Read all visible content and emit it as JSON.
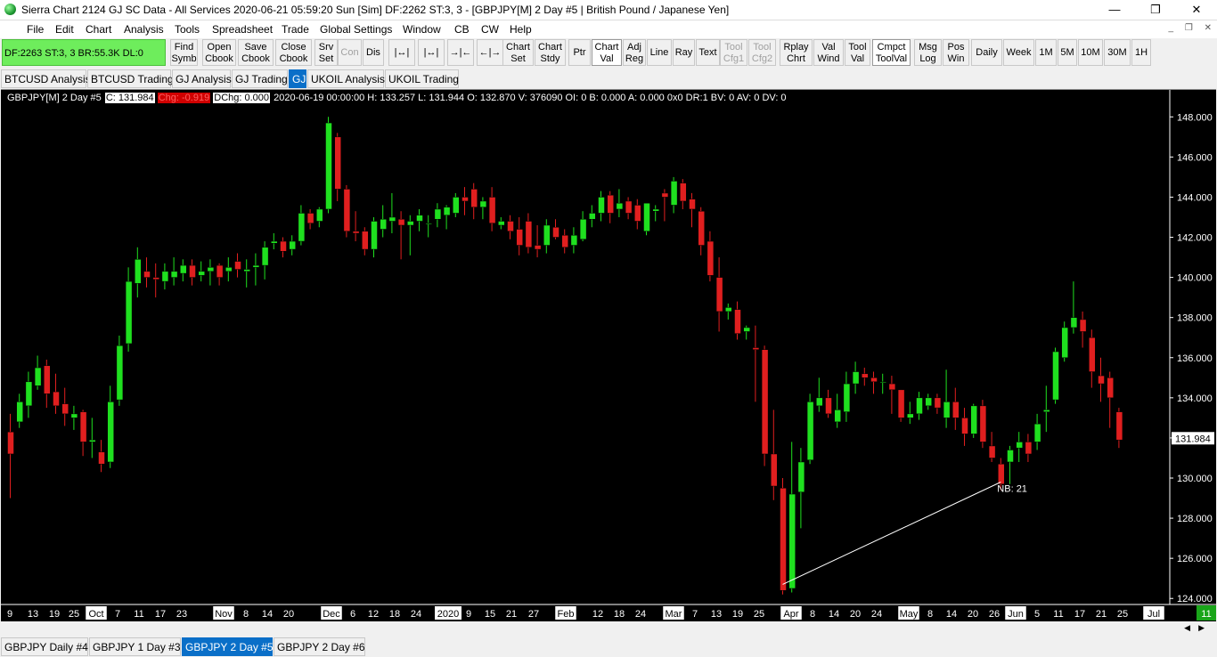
{
  "window": {
    "title": "Sierra Chart 2124 GJ  SC Data - All Services 2020-06-21  05:59:20 Sun [Sim]  DF:2262  ST:3, 3 - [GBPJPY[M]  2 Day  #5 | British Pound / Japanese Yen]",
    "minimize": "—",
    "restore": "❐",
    "close": "✕"
  },
  "menu": [
    "File",
    "Edit",
    "Chart",
    "Analysis",
    "Tools",
    "Spreadsheet",
    "Trade",
    "Global Settings",
    "Window",
    "CB",
    "CW",
    "Help"
  ],
  "mdi": {
    "minimize": "_",
    "restore": "❐",
    "close": "✕"
  },
  "status_box": "DF:2263  ST:3, 3  BR:55.3K  DL:0",
  "toolbar": [
    {
      "id": "find-symb",
      "l1": "Find",
      "l2": "Symb"
    },
    {
      "id": "open-cbook",
      "l1": "Open",
      "l2": "Cbook"
    },
    {
      "id": "save-cbook",
      "l1": "Save",
      "l2": "Cbook"
    },
    {
      "id": "close-cbook",
      "l1": "Close",
      "l2": "Cbook"
    },
    {
      "id": "srv-set",
      "l1": "Srv",
      "l2": "Set"
    },
    {
      "id": "con",
      "l1": "Con",
      "l2": ""
    },
    {
      "id": "dis",
      "l1": "Dis",
      "l2": ""
    },
    {
      "id": "zoom-1",
      "l1": "|↔|",
      "l2": ""
    },
    {
      "id": "zoom-2",
      "l1": "|↔|",
      "l2": ""
    },
    {
      "id": "zoom-3",
      "l1": "→|←",
      "l2": ""
    },
    {
      "id": "zoom-4",
      "l1": "←|→",
      "l2": ""
    },
    {
      "id": "chart-set",
      "l1": "Chart",
      "l2": "Set"
    },
    {
      "id": "chart-stdy",
      "l1": "Chart",
      "l2": "Stdy"
    },
    {
      "id": "ptr",
      "l1": "Ptr",
      "l2": ""
    },
    {
      "id": "chart-val",
      "l1": "Chart",
      "l2": "Val"
    },
    {
      "id": "adj-reg",
      "l1": "Adj",
      "l2": "Reg"
    },
    {
      "id": "line",
      "l1": "Line",
      "l2": ""
    },
    {
      "id": "ray",
      "l1": "Ray",
      "l2": ""
    },
    {
      "id": "text",
      "l1": "Text",
      "l2": ""
    },
    {
      "id": "tool-cfg1",
      "l1": "Tool",
      "l2": "Cfg1"
    },
    {
      "id": "tool-cfg2",
      "l1": "Tool",
      "l2": "Cfg2"
    },
    {
      "id": "rplay-chrt",
      "l1": "Rplay",
      "l2": "Chrt"
    },
    {
      "id": "val-wind",
      "l1": "Val",
      "l2": "Wind"
    },
    {
      "id": "tool-val",
      "l1": "Tool",
      "l2": "Val"
    },
    {
      "id": "cmpct-toolval",
      "l1": "Cmpct",
      "l2": "ToolVal"
    },
    {
      "id": "msg-log",
      "l1": "Msg",
      "l2": "Log"
    },
    {
      "id": "pos-win",
      "l1": "Pos",
      "l2": "Win"
    },
    {
      "id": "daily",
      "l1": "Daily",
      "l2": ""
    },
    {
      "id": "week",
      "l1": "Week",
      "l2": ""
    },
    {
      "id": "1m",
      "l1": "1M",
      "l2": ""
    },
    {
      "id": "5m",
      "l1": "5M",
      "l2": ""
    },
    {
      "id": "10m",
      "l1": "10M",
      "l2": ""
    },
    {
      "id": "30m",
      "l1": "30M",
      "l2": ""
    },
    {
      "id": "1h",
      "l1": "1H",
      "l2": ""
    }
  ],
  "chartbook_tabs": [
    "BTCUSD Analysis",
    "BTCUSD Trading",
    "GJ Analysis",
    "GJ Trading",
    "GJ",
    "UKOIL Analysis",
    "UKOIL Trading"
  ],
  "chart_tabs": [
    "GBPJPY  Daily  #4",
    "GBPJPY  1 Day  #3",
    "GBPJPY  2 Day  #5",
    "GBPJPY  2 Day  #6"
  ],
  "info": {
    "symbol": "GBPJPY[M]  2 Day  #5",
    "close": "C: 131.984",
    "chg": "Chg: -0.919",
    "dchg": "DChg: 0.000",
    "rest": "2020-06-19 00:00:00 H: 133.257  L: 131.944  O: 132.870  V: 376090  OI: 0  B: 0.000  A: 0.000 0x0  DR:1  BV: 0  AV: 0  DV: 0"
  },
  "chart_data": {
    "type": "candlestick",
    "symbol": "GBPJPY",
    "ylim": [
      123.7,
      148.9
    ],
    "yticks": [
      "148.000",
      "146.000",
      "144.000",
      "142.000",
      "140.000",
      "138.000",
      "136.000",
      "134.000",
      "132.000",
      "130.000",
      "128.000",
      "126.000",
      "124.000"
    ],
    "last_price": "131.984",
    "xlabels": [
      "9",
      "13",
      "19",
      "25",
      "Oct",
      "7",
      "11",
      "17",
      "23",
      "Nov",
      "8",
      "14",
      "20",
      "Dec",
      "6",
      "12",
      "18",
      "24",
      "2020",
      "9",
      "15",
      "21",
      "27",
      "Feb",
      "12",
      "18",
      "24",
      "Mar",
      "7",
      "13",
      "19",
      "25",
      "Apr",
      "8",
      "14",
      "20",
      "24",
      "May",
      "8",
      "14",
      "20",
      "26",
      "Jun",
      "5",
      "11",
      "17",
      "21",
      "25",
      "Jul"
    ],
    "highlighted_xlabels": [
      "Oct",
      "Nov",
      "Dec",
      "2020",
      "Feb",
      "Mar",
      "Apr",
      "May",
      "Jun",
      "Jul"
    ],
    "scroll_badge": "11",
    "up_color": "#1fe01f",
    "down_color": "#e01f1f",
    "candles": [
      [
        132.3,
        131.2,
        129.0,
        133.2
      ],
      [
        132.8,
        133.8,
        132.5,
        134.2
      ],
      [
        133.6,
        134.8,
        133.0,
        135.3
      ],
      [
        134.6,
        135.5,
        134.4,
        136.1
      ],
      [
        135.6,
        134.2,
        133.5,
        135.9
      ],
      [
        134.3,
        133.6,
        133.2,
        135.2
      ],
      [
        133.7,
        133.2,
        132.6,
        134.5
      ],
      [
        133.0,
        133.2,
        132.4,
        133.6
      ],
      [
        133.3,
        131.8,
        131.1,
        133.4
      ],
      [
        131.8,
        131.9,
        131.0,
        133.0
      ],
      [
        131.3,
        130.7,
        130.3,
        131.9
      ],
      [
        130.8,
        133.8,
        130.5,
        134.6
      ],
      [
        133.9,
        136.6,
        133.6,
        137.1
      ],
      [
        136.7,
        139.8,
        136.3,
        140.5
      ],
      [
        139.7,
        140.9,
        139.0,
        141.5
      ],
      [
        140.3,
        140.0,
        139.5,
        141.0
      ],
      [
        140.0,
        139.9,
        139.0,
        140.7
      ],
      [
        139.8,
        140.3,
        139.4,
        140.7
      ],
      [
        140.0,
        140.3,
        139.6,
        141.0
      ],
      [
        140.2,
        140.6,
        139.8,
        140.9
      ],
      [
        140.6,
        140.0,
        139.6,
        140.9
      ],
      [
        140.1,
        140.3,
        139.8,
        140.8
      ],
      [
        140.3,
        140.5,
        139.6,
        140.9
      ],
      [
        140.6,
        140.0,
        139.6,
        140.7
      ],
      [
        140.3,
        140.5,
        139.8,
        141.0
      ],
      [
        140.8,
        140.4,
        140.0,
        141.2
      ],
      [
        140.3,
        140.4,
        139.5,
        140.9
      ],
      [
        140.5,
        140.6,
        139.6,
        141.2
      ],
      [
        140.6,
        141.5,
        139.9,
        141.8
      ],
      [
        141.7,
        141.8,
        141.4,
        142.2
      ],
      [
        141.8,
        141.3,
        141.0,
        142.0
      ],
      [
        141.4,
        141.8,
        141.1,
        142.1
      ],
      [
        141.8,
        143.2,
        141.6,
        143.6
      ],
      [
        143.2,
        142.7,
        142.4,
        143.4
      ],
      [
        142.8,
        143.4,
        142.5,
        143.5
      ],
      [
        143.4,
        147.7,
        143.2,
        148.0
      ],
      [
        147.0,
        144.4,
        143.8,
        147.2
      ],
      [
        144.4,
        142.3,
        142.0,
        144.6
      ],
      [
        142.3,
        142.2,
        141.8,
        143.3
      ],
      [
        142.3,
        141.4,
        141.1,
        142.5
      ],
      [
        141.4,
        142.8,
        141.0,
        143.0
      ],
      [
        142.4,
        142.9,
        142.0,
        143.6
      ],
      [
        142.8,
        143.0,
        142.2,
        144.2
      ],
      [
        142.9,
        142.6,
        140.9,
        143.3
      ],
      [
        142.6,
        142.8,
        141.1,
        143.1
      ],
      [
        142.8,
        143.1,
        142.3,
        143.4
      ],
      [
        142.7,
        142.7,
        142.0,
        143.1
      ],
      [
        142.9,
        143.4,
        142.5,
        143.7
      ],
      [
        143.1,
        143.5,
        142.4,
        143.6
      ],
      [
        143.2,
        144.0,
        143.0,
        144.2
      ],
      [
        144.0,
        143.8,
        143.1,
        144.5
      ],
      [
        144.4,
        143.5,
        142.9,
        144.7
      ],
      [
        143.5,
        143.8,
        142.9,
        144.0
      ],
      [
        144.0,
        142.7,
        142.3,
        144.5
      ],
      [
        142.6,
        142.8,
        142.4,
        143.0
      ],
      [
        142.8,
        142.3,
        141.9,
        143.1
      ],
      [
        142.4,
        141.6,
        141.1,
        143.0
      ],
      [
        142.8,
        141.5,
        141.2,
        143.2
      ],
      [
        141.6,
        141.4,
        141.0,
        142.6
      ],
      [
        141.6,
        142.6,
        141.2,
        142.9
      ],
      [
        142.5,
        142.0,
        141.9,
        142.9
      ],
      [
        142.1,
        141.5,
        141.2,
        142.4
      ],
      [
        141.6,
        142.1,
        141.2,
        142.5
      ],
      [
        141.9,
        142.9,
        141.8,
        143.3
      ],
      [
        142.9,
        143.2,
        142.5,
        143.6
      ],
      [
        143.2,
        144.0,
        142.8,
        144.3
      ],
      [
        144.1,
        143.2,
        142.7,
        144.3
      ],
      [
        143.4,
        143.7,
        143.0,
        144.4
      ],
      [
        143.8,
        143.2,
        142.9,
        144.0
      ],
      [
        143.6,
        142.8,
        142.4,
        143.9
      ],
      [
        142.3,
        143.7,
        142.1,
        143.7
      ],
      [
        143.3,
        143.4,
        142.8,
        143.6
      ],
      [
        144.2,
        144.0,
        142.8,
        144.4
      ],
      [
        143.6,
        144.8,
        143.2,
        145.0
      ],
      [
        144.7,
        143.8,
        143.4,
        144.9
      ],
      [
        143.9,
        143.4,
        142.5,
        144.2
      ],
      [
        143.3,
        141.6,
        141.1,
        143.5
      ],
      [
        141.8,
        140.1,
        139.8,
        142.3
      ],
      [
        140.0,
        138.3,
        137.3,
        141.0
      ],
      [
        138.3,
        138.5,
        137.9,
        138.7
      ],
      [
        138.4,
        137.2,
        136.9,
        138.8
      ],
      [
        137.3,
        137.5,
        136.9,
        137.6
      ],
      [
        136.5,
        136.4,
        133.8,
        137.6
      ],
      [
        136.4,
        131.2,
        130.6,
        136.6
      ],
      [
        131.2,
        129.6,
        128.9,
        133.4
      ],
      [
        129.5,
        124.4,
        124.2,
        130.0
      ],
      [
        124.5,
        129.2,
        124.3,
        131.8
      ],
      [
        129.3,
        130.8,
        127.5,
        131.5
      ],
      [
        130.9,
        133.8,
        130.7,
        134.2
      ],
      [
        133.6,
        134.0,
        133.3,
        135.0
      ],
      [
        134.0,
        133.2,
        133.0,
        134.4
      ],
      [
        132.8,
        133.4,
        132.5,
        134.2
      ],
      [
        133.3,
        134.7,
        132.8,
        135.3
      ],
      [
        134.7,
        135.3,
        134.2,
        135.8
      ],
      [
        135.2,
        135.0,
        134.6,
        135.5
      ],
      [
        135.0,
        134.8,
        134.2,
        135.3
      ],
      [
        134.8,
        134.8,
        134.2,
        135.2
      ],
      [
        134.7,
        134.4,
        133.2,
        135.1
      ],
      [
        134.4,
        133.0,
        132.8,
        134.4
      ],
      [
        133.0,
        133.2,
        132.7,
        133.8
      ],
      [
        133.2,
        134.0,
        132.9,
        134.3
      ],
      [
        133.6,
        134.0,
        133.4,
        134.2
      ],
      [
        134.0,
        133.5,
        133.2,
        134.2
      ],
      [
        133.0,
        133.8,
        132.5,
        135.4
      ],
      [
        133.8,
        133.0,
        132.4,
        134.5
      ],
      [
        133.0,
        132.2,
        131.6,
        133.5
      ],
      [
        132.2,
        133.6,
        132.0,
        133.7
      ],
      [
        133.6,
        131.8,
        131.5,
        133.9
      ],
      [
        131.6,
        131.0,
        130.8,
        132.3
      ],
      [
        130.7,
        129.7,
        129.4,
        131.0
      ],
      [
        130.8,
        131.4,
        129.7,
        131.6
      ],
      [
        131.5,
        131.8,
        130.8,
        132.3
      ],
      [
        131.8,
        131.2,
        130.8,
        132.2
      ],
      [
        131.8,
        132.7,
        131.4,
        133.2
      ],
      [
        133.3,
        133.4,
        132.3,
        134.6
      ],
      [
        133.9,
        136.3,
        133.7,
        136.5
      ],
      [
        136.0,
        137.5,
        135.8,
        137.8
      ],
      [
        137.5,
        138.0,
        137.2,
        139.8
      ],
      [
        137.9,
        137.3,
        136.5,
        138.3
      ],
      [
        137.0,
        135.3,
        134.5,
        137.4
      ],
      [
        135.1,
        134.7,
        133.8,
        136.0
      ],
      [
        135.0,
        134.0,
        132.5,
        135.3
      ],
      [
        133.3,
        131.9,
        131.5,
        133.5
      ]
    ],
    "trendline": {
      "from_index": 85,
      "from_price": 124.7,
      "to_index": 109,
      "to_price": 129.8
    },
    "annotation": "NB: 21"
  }
}
